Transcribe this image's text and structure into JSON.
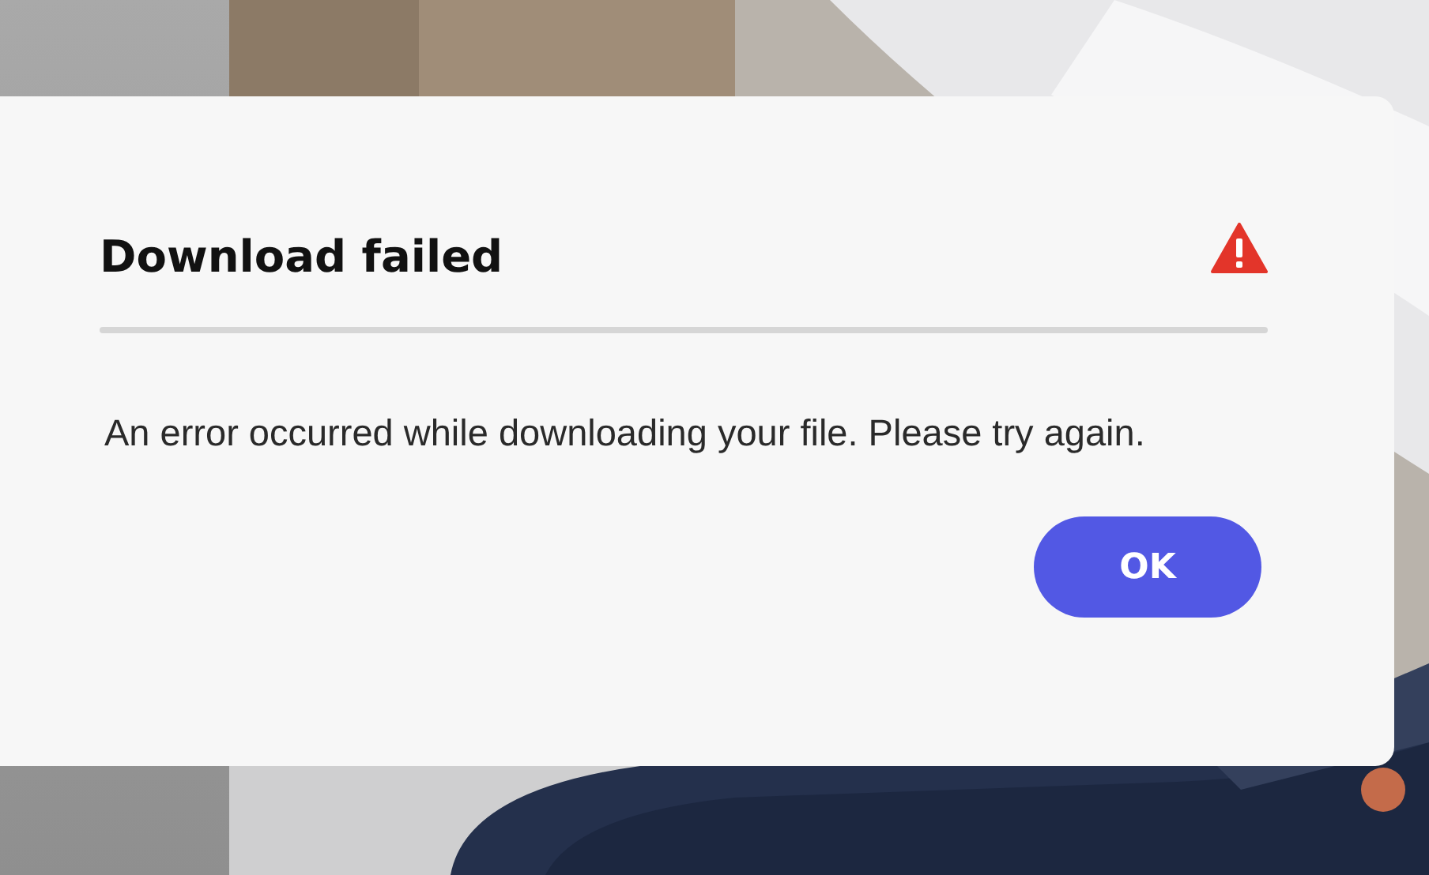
{
  "dialog": {
    "title": "Download failed",
    "kind": "warning",
    "message": "An error occurred while downloading your file. Please try again.",
    "buttons": [
      {
        "label": "OK"
      }
    ]
  }
}
